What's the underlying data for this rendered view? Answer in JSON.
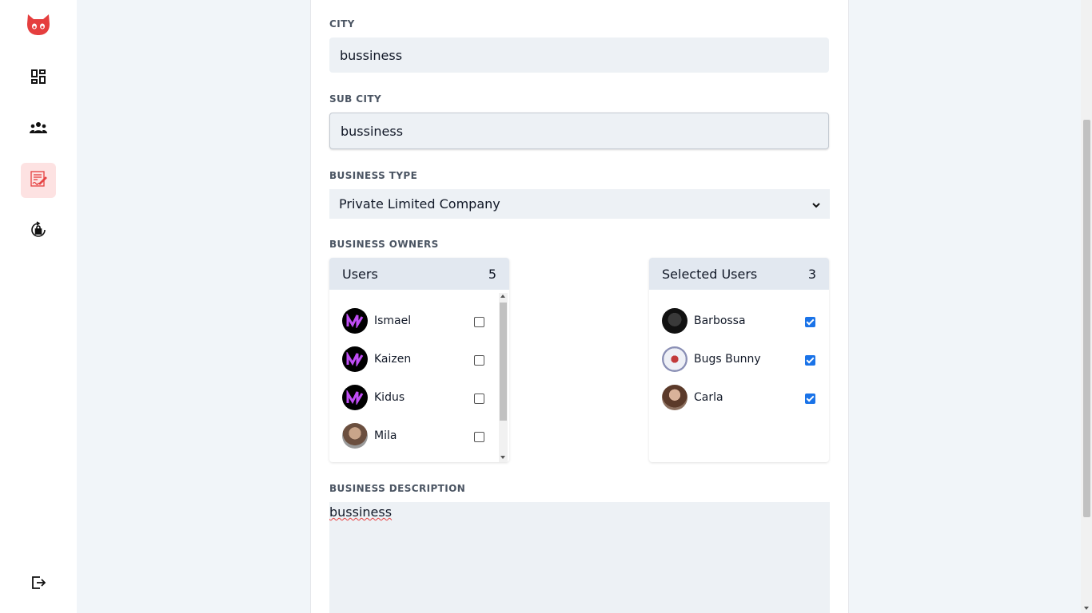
{
  "sidebar": {
    "logo": "octocat-logo",
    "items": [
      {
        "icon": "dashboard-icon"
      },
      {
        "icon": "users-icon"
      },
      {
        "icon": "edit-document-icon",
        "active": true
      },
      {
        "icon": "lock-reset-icon"
      }
    ],
    "logout_icon": "logout-icon"
  },
  "form": {
    "city_label": "CITY",
    "city_value": "bussiness",
    "subcity_label": "SUB CITY",
    "subcity_value": "bussiness",
    "business_type_label": "BUSINESS TYPE",
    "business_type_value": "Private Limited Company",
    "business_owners_label": "BUSINESS OWNERS",
    "users_panel": {
      "title": "Users",
      "count": "5",
      "items": [
        {
          "name": "Ismael",
          "checked": false
        },
        {
          "name": "Kaizen",
          "checked": false
        },
        {
          "name": "Kidus",
          "checked": false
        },
        {
          "name": "Mila",
          "checked": false
        }
      ]
    },
    "selected_panel": {
      "title": "Selected Users",
      "count": "3",
      "items": [
        {
          "name": "Barbossa",
          "checked": true
        },
        {
          "name": "Bugs Bunny",
          "checked": true
        },
        {
          "name": "Carla",
          "checked": true
        }
      ]
    },
    "description_label": "BUSINESS DESCRIPTION",
    "description_value": "bussiness"
  },
  "colors": {
    "accent": "#e53e3e",
    "active_bg": "#fde2e2",
    "field_bg": "#edf1f5",
    "panel_head_bg": "#e2e8f0",
    "checkbox": "#1a73e8"
  }
}
